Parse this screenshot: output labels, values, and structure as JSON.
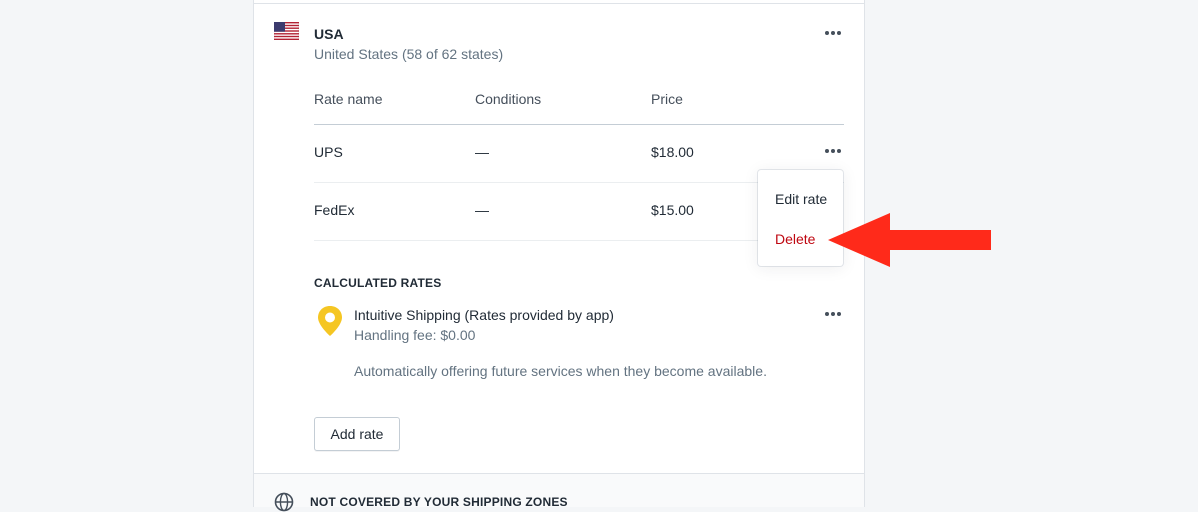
{
  "zone": {
    "name": "USA",
    "subtitle": "United States (58 of 62 states)",
    "flag_icon": "us-flag-icon"
  },
  "table": {
    "headers": [
      "Rate name",
      "Conditions",
      "Price"
    ],
    "rows": [
      {
        "name": "UPS",
        "conditions": "—",
        "price": "$18.00"
      },
      {
        "name": "FedEx",
        "conditions": "—",
        "price": "$15.00"
      }
    ]
  },
  "calculated": {
    "title": "CALCULATED RATES",
    "name": "Intuitive Shipping (Rates provided by app)",
    "fee": "Handling fee: $0.00",
    "note": "Automatically offering future services when they become available.",
    "icon": "location-pin-icon",
    "icon_color": "#f5c623"
  },
  "buttons": {
    "add_rate": "Add rate"
  },
  "menu": {
    "edit": "Edit rate",
    "delete": "Delete",
    "delete_color": "#bf0711"
  },
  "footer": {
    "text": "NOT COVERED BY YOUR SHIPPING ZONES",
    "icon": "globe-icon"
  },
  "annotation": {
    "arrow_color": "#ff2a1a",
    "icon": "red-arrow-icon"
  }
}
